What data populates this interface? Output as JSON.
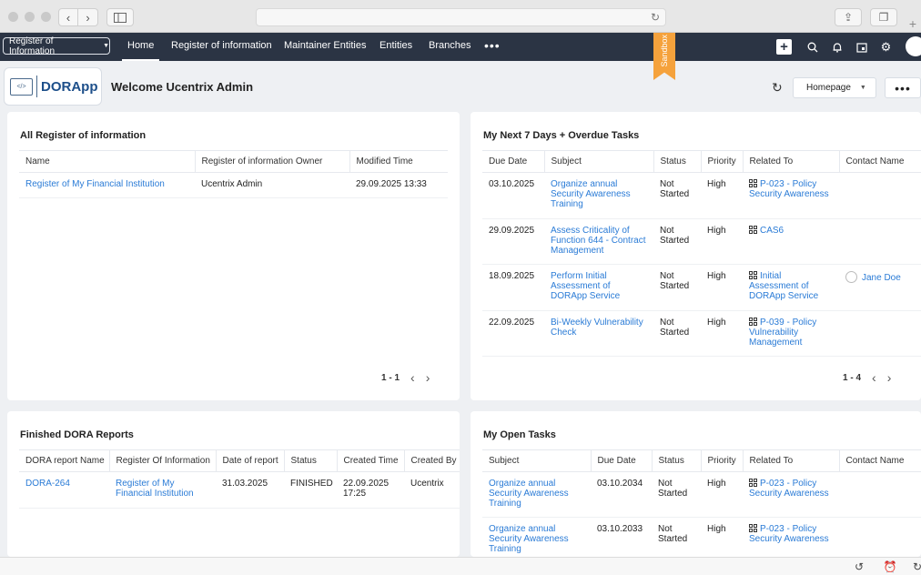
{
  "browser": {
    "back_icon": "chevron-left-icon",
    "forward_icon": "chevron-right-icon",
    "reload_icon": "reload-icon",
    "share_icon": "share-icon",
    "tabs_icon": "tabs-icon",
    "newtab_icon": "plus-icon"
  },
  "nav": {
    "module_selector": "Register of Information",
    "tabs": [
      {
        "label": "Home",
        "active": true
      },
      {
        "label": "Register of information"
      },
      {
        "label": "Maintainer Entities"
      },
      {
        "label": "Entities"
      },
      {
        "label": "Branches"
      }
    ],
    "more": "•••",
    "sandbox": "Sandbox"
  },
  "header": {
    "logo_text": "DORApp",
    "welcome": "Welcome Ucentrix Admin",
    "homepage_button": "Homepage",
    "more_button": "•••"
  },
  "register_card": {
    "title": "All Register of information",
    "columns": [
      "Name",
      "Register of information Owner",
      "Modified Time"
    ],
    "rows": [
      {
        "name": "Register of My Financial Institution",
        "owner": "Ucentrix Admin",
        "modified": "29.09.2025 13:33"
      }
    ],
    "pager": "1 - 1"
  },
  "tasks_card": {
    "title": "My Next 7 Days + Overdue Tasks",
    "columns": [
      "Due Date",
      "Subject",
      "Status",
      "Priority",
      "Related To",
      "Contact Name"
    ],
    "rows": [
      {
        "due": "03.10.2025",
        "subject": "Organize annual Security Awareness Training",
        "status": "Not Started",
        "priority": "High",
        "related": "P-023 - Policy Security Awareness",
        "contact": ""
      },
      {
        "due": "29.09.2025",
        "subject": "Assess Criticality of Function 644 - Contract Management",
        "status": "Not Started",
        "priority": "High",
        "related": "CAS6",
        "contact": ""
      },
      {
        "due": "18.09.2025",
        "subject": "Perform Initial Assessment of DORApp Service",
        "status": "Not Started",
        "priority": "High",
        "related": "Initial Assessment of DORApp Service",
        "contact": "Jane Doe"
      },
      {
        "due": "22.09.2025",
        "subject": "Bi-Weekly Vulnerability Check",
        "status": "Not Started",
        "priority": "High",
        "related": "P-039 - Policy Vulnerability Management",
        "contact": ""
      }
    ],
    "pager": "1 - 4"
  },
  "reports_card": {
    "title": "Finished DORA Reports",
    "columns": [
      "DORA report Name",
      "Register Of Information",
      "Date of report",
      "Status",
      "Created Time",
      "Created By"
    ],
    "rows": [
      {
        "name": "DORA-264",
        "register": "Register of My Financial Institution",
        "date": "31.03.2025",
        "status": "FINISHED",
        "created": "22.09.2025 17:25",
        "by": "Ucentrix"
      }
    ]
  },
  "open_tasks_card": {
    "title": "My Open Tasks",
    "columns": [
      "Subject",
      "Due Date",
      "Status",
      "Priority",
      "Related To",
      "Contact Name"
    ],
    "rows": [
      {
        "subject": "Organize annual Security Awareness Training",
        "due": "03.10.2034",
        "status": "Not Started",
        "priority": "High",
        "related": "P-023 - Policy Security Awareness"
      },
      {
        "subject": "Organize annual Security Awareness Training",
        "due": "03.10.2033",
        "status": "Not Started",
        "priority": "High",
        "related": "P-023 - Policy Security Awareness"
      }
    ]
  }
}
